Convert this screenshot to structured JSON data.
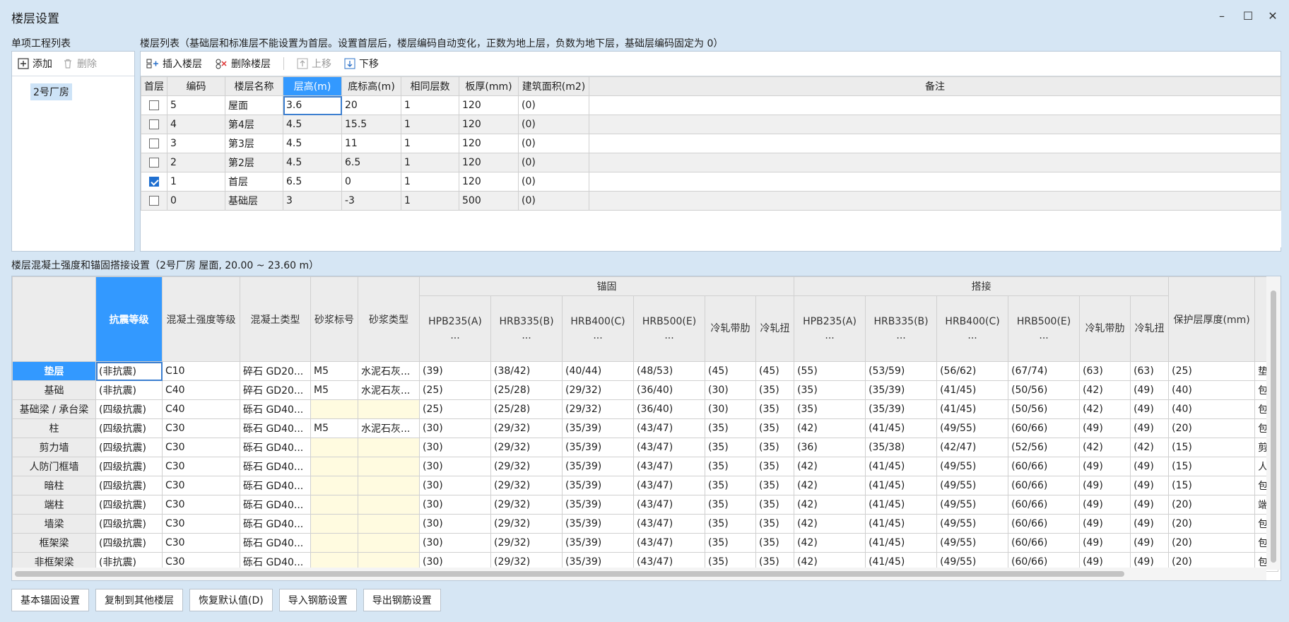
{
  "window": {
    "title": "楼层设置"
  },
  "project_panel": {
    "heading": "单项工程列表",
    "add_label": "添加",
    "delete_label": "删除",
    "items": [
      "2号厂房"
    ]
  },
  "floor_panel": {
    "heading": "楼层列表（基础层和标准层不能设置为首层。设置首层后，楼层编码自动变化，正数为地上层，负数为地下层，基础层编码固定为 0）",
    "toolbar": {
      "insert": "插入楼层",
      "delete": "删除楼层",
      "up": "上移",
      "down": "下移"
    },
    "columns": [
      "首层",
      "编码",
      "楼层名称",
      "层高(m)",
      "底标高(m)",
      "相同层数",
      "板厚(mm)",
      "建筑面积(m2)",
      "备注"
    ],
    "rows": [
      {
        "first": false,
        "code": "5",
        "name": "屋面",
        "height": "3.6",
        "base": "20",
        "same": "1",
        "thick": "120",
        "area": "(0)",
        "note": ""
      },
      {
        "first": false,
        "code": "4",
        "name": "第4层",
        "height": "4.5",
        "base": "15.5",
        "same": "1",
        "thick": "120",
        "area": "(0)",
        "note": ""
      },
      {
        "first": false,
        "code": "3",
        "name": "第3层",
        "height": "4.5",
        "base": "11",
        "same": "1",
        "thick": "120",
        "area": "(0)",
        "note": ""
      },
      {
        "first": false,
        "code": "2",
        "name": "第2层",
        "height": "4.5",
        "base": "6.5",
        "same": "1",
        "thick": "120",
        "area": "(0)",
        "note": ""
      },
      {
        "first": true,
        "code": "1",
        "name": "首层",
        "height": "6.5",
        "base": "0",
        "same": "1",
        "thick": "120",
        "area": "(0)",
        "note": ""
      },
      {
        "first": false,
        "code": "0",
        "name": "基础层",
        "height": "3",
        "base": "-3",
        "same": "1",
        "thick": "500",
        "area": "(0)",
        "note": ""
      }
    ]
  },
  "concrete_panel": {
    "heading": "楼层混凝土强度和锚固搭接设置（2号厂房  屋面, 20.00 ~ 23.60 m）",
    "group_anchor": "锚固",
    "group_lap": "搭接",
    "col_headers": {
      "seismic": "抗震等级",
      "concrete_grade": "混凝土强度等级",
      "concrete_type": "混凝土类型",
      "mortar_grade": "砂浆标号",
      "mortar_type": "砂浆类型",
      "bars": [
        "HPB235(A)",
        "HRB335(B)",
        "HRB400(C)",
        "HRB500(E)",
        "冷轧带肋",
        "冷轧扭"
      ],
      "ellipsis": "...",
      "cover": "保护层厚度(mm)"
    },
    "rows": [
      {
        "name": "垫层",
        "seismic": "(非抗震)",
        "grade": "C10",
        "ctype": "碎石 GD20...",
        "mgrade": "M5",
        "mtype": "水泥石灰...",
        "anchor": [
          "(39)",
          "(38/42)",
          "(40/44)",
          "(48/53)",
          "(45)",
          "(45)"
        ],
        "lap": [
          "(55)",
          "(53/59)",
          "(56/62)",
          "(67/74)",
          "(63)",
          "(63)"
        ],
        "cover": "(25)",
        "note": "垫"
      },
      {
        "name": "基础",
        "seismic": "(非抗震)",
        "grade": "C40",
        "ctype": "碎石 GD20...",
        "mgrade": "M5",
        "mtype": "水泥石灰...",
        "anchor": [
          "(25)",
          "(25/28)",
          "(29/32)",
          "(36/40)",
          "(30)",
          "(35)"
        ],
        "lap": [
          "(35)",
          "(35/39)",
          "(41/45)",
          "(50/56)",
          "(42)",
          "(49)"
        ],
        "cover": "(40)",
        "note": "包"
      },
      {
        "name": "基础梁 / 承台梁",
        "seismic": "(四级抗震)",
        "grade": "C40",
        "ctype": "砾石 GD40...",
        "mgrade": "",
        "mtype": "",
        "anchor": [
          "(25)",
          "(25/28)",
          "(29/32)",
          "(36/40)",
          "(30)",
          "(35)"
        ],
        "lap": [
          "(35)",
          "(35/39)",
          "(41/45)",
          "(50/56)",
          "(42)",
          "(49)"
        ],
        "cover": "(40)",
        "note": "包"
      },
      {
        "name": "柱",
        "seismic": "(四级抗震)",
        "grade": "C30",
        "ctype": "砾石 GD40...",
        "mgrade": "M5",
        "mtype": "水泥石灰...",
        "anchor": [
          "(30)",
          "(29/32)",
          "(35/39)",
          "(43/47)",
          "(35)",
          "(35)"
        ],
        "lap": [
          "(42)",
          "(41/45)",
          "(49/55)",
          "(60/66)",
          "(49)",
          "(49)"
        ],
        "cover": "(20)",
        "note": "包"
      },
      {
        "name": "剪力墙",
        "seismic": "(四级抗震)",
        "grade": "C30",
        "ctype": "砾石 GD40...",
        "mgrade": "",
        "mtype": "",
        "anchor": [
          "(30)",
          "(29/32)",
          "(35/39)",
          "(43/47)",
          "(35)",
          "(35)"
        ],
        "lap": [
          "(36)",
          "(35/38)",
          "(42/47)",
          "(52/56)",
          "(42)",
          "(42)"
        ],
        "cover": "(15)",
        "note": "剪"
      },
      {
        "name": "人防门框墙",
        "seismic": "(四级抗震)",
        "grade": "C30",
        "ctype": "砾石 GD40...",
        "mgrade": "",
        "mtype": "",
        "anchor": [
          "(30)",
          "(29/32)",
          "(35/39)",
          "(43/47)",
          "(35)",
          "(35)"
        ],
        "lap": [
          "(42)",
          "(41/45)",
          "(49/55)",
          "(60/66)",
          "(49)",
          "(49)"
        ],
        "cover": "(15)",
        "note": "人"
      },
      {
        "name": "暗柱",
        "seismic": "(四级抗震)",
        "grade": "C30",
        "ctype": "砾石 GD40...",
        "mgrade": "",
        "mtype": "",
        "anchor": [
          "(30)",
          "(29/32)",
          "(35/39)",
          "(43/47)",
          "(35)",
          "(35)"
        ],
        "lap": [
          "(42)",
          "(41/45)",
          "(49/55)",
          "(60/66)",
          "(49)",
          "(49)"
        ],
        "cover": "(15)",
        "note": "包"
      },
      {
        "name": "端柱",
        "seismic": "(四级抗震)",
        "grade": "C30",
        "ctype": "砾石 GD40...",
        "mgrade": "",
        "mtype": "",
        "anchor": [
          "(30)",
          "(29/32)",
          "(35/39)",
          "(43/47)",
          "(35)",
          "(35)"
        ],
        "lap": [
          "(42)",
          "(41/45)",
          "(49/55)",
          "(60/66)",
          "(49)",
          "(49)"
        ],
        "cover": "(20)",
        "note": "端"
      },
      {
        "name": "墙梁",
        "seismic": "(四级抗震)",
        "grade": "C30",
        "ctype": "砾石 GD40...",
        "mgrade": "",
        "mtype": "",
        "anchor": [
          "(30)",
          "(29/32)",
          "(35/39)",
          "(43/47)",
          "(35)",
          "(35)"
        ],
        "lap": [
          "(42)",
          "(41/45)",
          "(49/55)",
          "(60/66)",
          "(49)",
          "(49)"
        ],
        "cover": "(20)",
        "note": "包"
      },
      {
        "name": "框架梁",
        "seismic": "(四级抗震)",
        "grade": "C30",
        "ctype": "砾石 GD40...",
        "mgrade": "",
        "mtype": "",
        "anchor": [
          "(30)",
          "(29/32)",
          "(35/39)",
          "(43/47)",
          "(35)",
          "(35)"
        ],
        "lap": [
          "(42)",
          "(41/45)",
          "(49/55)",
          "(60/66)",
          "(49)",
          "(49)"
        ],
        "cover": "(20)",
        "note": "包"
      },
      {
        "name": "非框架梁",
        "seismic": "(非抗震)",
        "grade": "C30",
        "ctype": "砾石 GD40...",
        "mgrade": "",
        "mtype": "",
        "anchor": [
          "(30)",
          "(29/32)",
          "(35/39)",
          "(43/47)",
          "(35)",
          "(35)"
        ],
        "lap": [
          "(42)",
          "(41/45)",
          "(49/55)",
          "(60/66)",
          "(49)",
          "(49)"
        ],
        "cover": "(20)",
        "note": "包"
      }
    ]
  },
  "bottom_buttons": [
    "基本锚固设置",
    "复制到其他楼层",
    "恢复默认值(D)",
    "导入钢筋设置",
    "导出钢筋设置"
  ]
}
